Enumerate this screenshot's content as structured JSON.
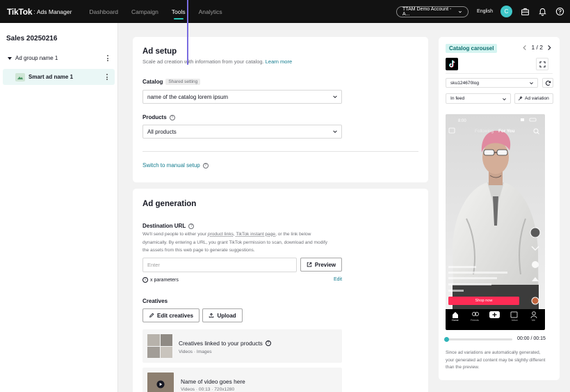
{
  "app": {
    "brand": "TikTok",
    "brand_sub": "Ads Manager"
  },
  "nav": {
    "items": [
      "Dashboard",
      "Campaign",
      "Tools",
      "Analytics"
    ],
    "active": "Tools"
  },
  "topbar": {
    "account": "TTAM Demo Account - A...",
    "language": "English",
    "avatar_initial": "C"
  },
  "sidebar": {
    "campaign": "Sales 20250216",
    "ad_group": "Ad group name 1",
    "ad": "Smart ad name 1"
  },
  "ad_setup": {
    "title": "Ad setup",
    "subtitle": "Scale ad creation with information from your catalog.",
    "learn_more": "Learn more",
    "catalog_label": "Catalog",
    "shared_badge": "Shared setting",
    "catalog_value": "name of the catalog lorem ipsum",
    "products_label": "Products",
    "products_value": "All products",
    "manual_link": "Switch to manual setup"
  },
  "ad_generation": {
    "title": "Ad generation",
    "dest_label": "Destination URL",
    "desc_1": "We'll send people to either your",
    "desc_link1": "product links",
    "desc_2": ",",
    "desc_link2": "TikTok instant page",
    "desc_3": ", or the link below",
    "desc_line2": "dynamically. By entering a URL, you grant TikTok permission to scan, download and modify",
    "desc_line3": "the assets from this web page to generate suggestions.",
    "url_placeholder": "Enter",
    "preview_button": "Preview",
    "params": "x parameters",
    "edit": "Edit",
    "creatives_label": "Creatives",
    "edit_creatives": "Edit creatives",
    "upload": "Upload",
    "row1_title": "Creatives linked to your products",
    "row1_sub": "Videos · Images",
    "row2_title": "Name of video goes here",
    "row2_sub": "Videos · 00:13 · 720x1280"
  },
  "preview": {
    "tag": "Catalog carousel",
    "page": "1 / 2",
    "sku": "sku124670log",
    "placement": "In feed",
    "variation": "Ad variation",
    "phone_time": "8:00",
    "phone_following": "Following",
    "phone_for_you": "For You",
    "cta": "Shop now",
    "nav": [
      "Home",
      "Friends",
      "",
      "Inbox",
      "Me"
    ],
    "time": "00:00 / 00:15",
    "note": "Since ad variations are automatically generated, your generated ad content may be slightly different than the preview."
  },
  "colors": {
    "accent": "#2bc8b8",
    "link": "#127b8e",
    "cta": "#fe2c55",
    "topbar": "#121212"
  }
}
